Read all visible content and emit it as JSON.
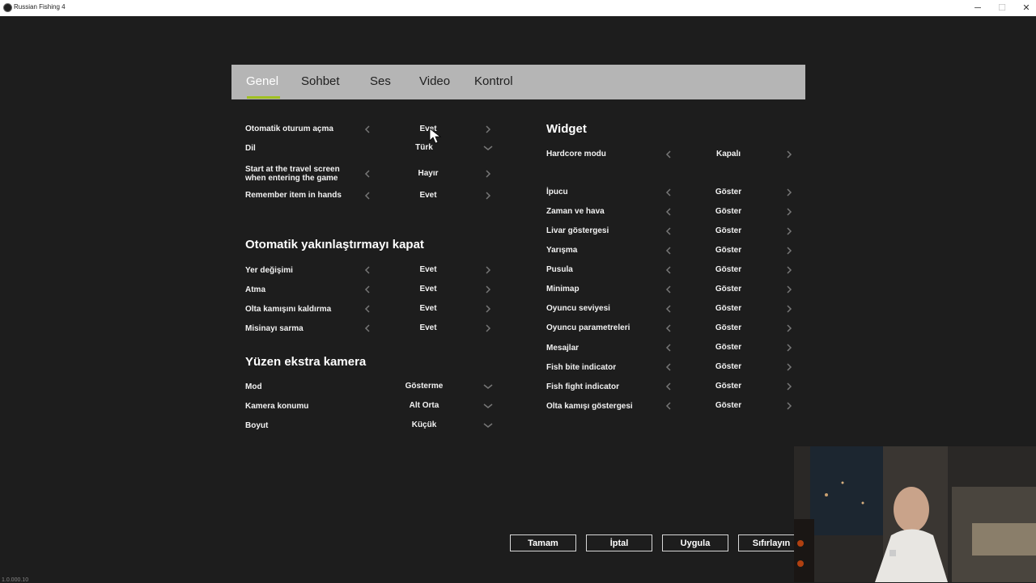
{
  "window": {
    "title": "Russian Fishing 4",
    "minimize": "─",
    "maximize": "☐",
    "close": "✕"
  },
  "tabs": [
    {
      "label": "Genel",
      "active": true
    },
    {
      "label": "Sohbet",
      "active": false
    },
    {
      "label": "Ses",
      "active": false
    },
    {
      "label": "Video",
      "active": false
    },
    {
      "label": "Kontrol",
      "active": false
    }
  ],
  "left": {
    "rows": [
      {
        "label": "Otomatik oturum açma",
        "value": "Evet",
        "type": "arrows"
      },
      {
        "label": "Dil",
        "value": "Türk",
        "type": "dropdown"
      },
      {
        "label": "Start at the travel screen when entering the game",
        "value": "Hayır",
        "type": "arrows"
      },
      {
        "label": "Remember item in hands",
        "value": "Evet",
        "type": "arrows"
      }
    ],
    "zoom_section": {
      "title": "Otomatik yakınlaştırmayı kapat",
      "rows": [
        {
          "label": "Yer değişimi",
          "value": "Evet"
        },
        {
          "label": "Atma",
          "value": "Evet"
        },
        {
          "label": "Olta kamışını kaldırma",
          "value": "Evet"
        },
        {
          "label": "Misinayı sarma",
          "value": "Evet"
        }
      ]
    },
    "camera_section": {
      "title": "Yüzen ekstra kamera",
      "rows": [
        {
          "label": "Mod",
          "value": "Gösterme"
        },
        {
          "label": "Kamera konumu",
          "value": "Alt Orta"
        },
        {
          "label": "Boyut",
          "value": "Küçük"
        }
      ]
    }
  },
  "right": {
    "title": "Widget",
    "hardcore": {
      "label": "Hardcore modu",
      "value": "Kapalı"
    },
    "rows": [
      {
        "label": "İpucu",
        "value": "Göster"
      },
      {
        "label": "Zaman ve hava",
        "value": "Göster"
      },
      {
        "label": "Livar göstergesi",
        "value": "Göster"
      },
      {
        "label": "Yarışma",
        "value": "Göster"
      },
      {
        "label": "Pusula",
        "value": "Göster"
      },
      {
        "label": "Minimap",
        "value": "Göster"
      },
      {
        "label": "Oyuncu seviyesi",
        "value": "Göster"
      },
      {
        "label": "Oyuncu parametreleri",
        "value": "Göster"
      },
      {
        "label": "Mesajlar",
        "value": "Göster"
      },
      {
        "label": "Fish bite indicator",
        "value": "Göster"
      },
      {
        "label": "Fish fight indicator",
        "value": "Göster"
      },
      {
        "label": "Olta kamışı göstergesi",
        "value": "Göster"
      }
    ]
  },
  "footer": {
    "ok": "Tamam",
    "cancel": "İptal",
    "apply": "Uygula",
    "reset": "Sıfırlayın"
  },
  "version": "1.0.000.10",
  "colors": {
    "accent": "#a0c020",
    "tabbar": "#b5b5b5",
    "background": "#1d1d1d"
  },
  "icons": {
    "left_arrow": "chevron-left-icon",
    "right_arrow": "chevron-right-icon",
    "dropdown": "chevron-down-icon"
  }
}
